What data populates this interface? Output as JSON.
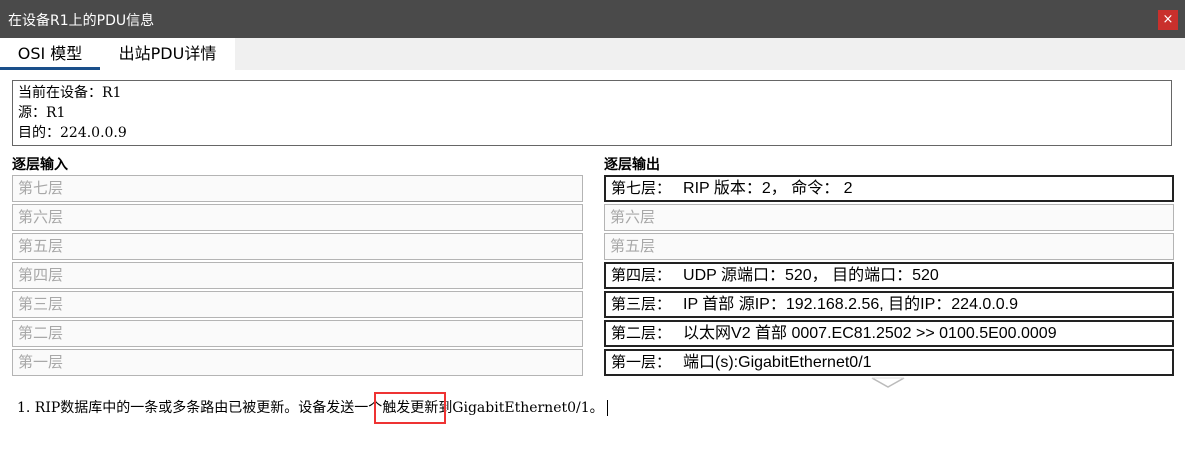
{
  "window": {
    "title": "在设备R1上的PDU信息",
    "close_label": "×"
  },
  "tabs": [
    {
      "label": "OSI 模型",
      "active": true
    },
    {
      "label": "出站PDU详情",
      "active": false
    }
  ],
  "device_info": {
    "current_device": "当前在设备：R1",
    "source": "源：R1",
    "destination": "目的：224.0.0.9"
  },
  "in_layers": {
    "heading": "逐层输入",
    "items": [
      {
        "name": "第七层"
      },
      {
        "name": "第六层"
      },
      {
        "name": "第五层"
      },
      {
        "name": "第四层"
      },
      {
        "name": "第三层"
      },
      {
        "name": "第二层"
      },
      {
        "name": "第一层"
      }
    ]
  },
  "out_layers": {
    "heading": "逐层输出",
    "items": [
      {
        "name": "第七层：",
        "detail": "RIP 版本：2， 命令： 2",
        "active": true
      },
      {
        "name": "第六层",
        "detail": "",
        "active": false
      },
      {
        "name": "第五层",
        "detail": "",
        "active": false
      },
      {
        "name": "第四层：",
        "detail": "UDP 源端口：520， 目的端口：520",
        "active": true
      },
      {
        "name": "第三层：",
        "detail": "IP 首部 源IP：192.168.2.56, 目的IP：224.0.0.9",
        "active": true
      },
      {
        "name": "第二层：",
        "detail": "以太网V2 首部 0007.EC81.2502 >> 0100.5E00.0009",
        "active": true
      },
      {
        "name": "第一层：",
        "detail": "端口(s):GigabitEthernet0/1",
        "active": true
      }
    ]
  },
  "message": {
    "before": "1. RIP数据库中的一条或多条路由已被更新。设备发送一个",
    "highlight": "触发更新",
    "after": "到GigabitEthernet0/1。"
  },
  "colors": {
    "titlebar": "#4a4a4a",
    "close": "#c9302c",
    "tab_underline": "#1a4f8a",
    "highlight_box": "#e33333"
  },
  "icons": {
    "close": "close-icon",
    "chevron": "chevron-down-icon"
  }
}
